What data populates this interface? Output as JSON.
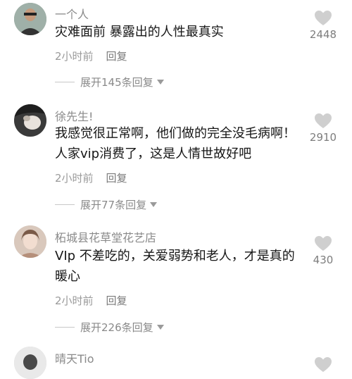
{
  "comments": [
    {
      "username": "一个人",
      "text": "灾难面前  暴露出的人性最真实",
      "time": "2小时前",
      "reply_label": "回复",
      "likes": "2448",
      "expand_label": "展开145条回复"
    },
    {
      "username": "徐先生!",
      "text": "我感觉很正常啊，他们做的完全没毛病啊！人家vip消费了，这是人情世故好吧",
      "time": "2小时前",
      "reply_label": "回复",
      "likes": "2910",
      "expand_label": "展开77条回复"
    },
    {
      "username": "柘城县花草堂花艺店",
      "text": "VIp 不差吃的，关爱弱势和老人，才是真的暖心",
      "time": "2小时前",
      "reply_label": "回复",
      "likes": "430",
      "expand_label": "展开226条回复"
    },
    {
      "username": "晴天Tio"
    }
  ],
  "colors": {
    "heart": "#cfcfcf",
    "username": "#8a8a8a",
    "text": "#161616"
  }
}
